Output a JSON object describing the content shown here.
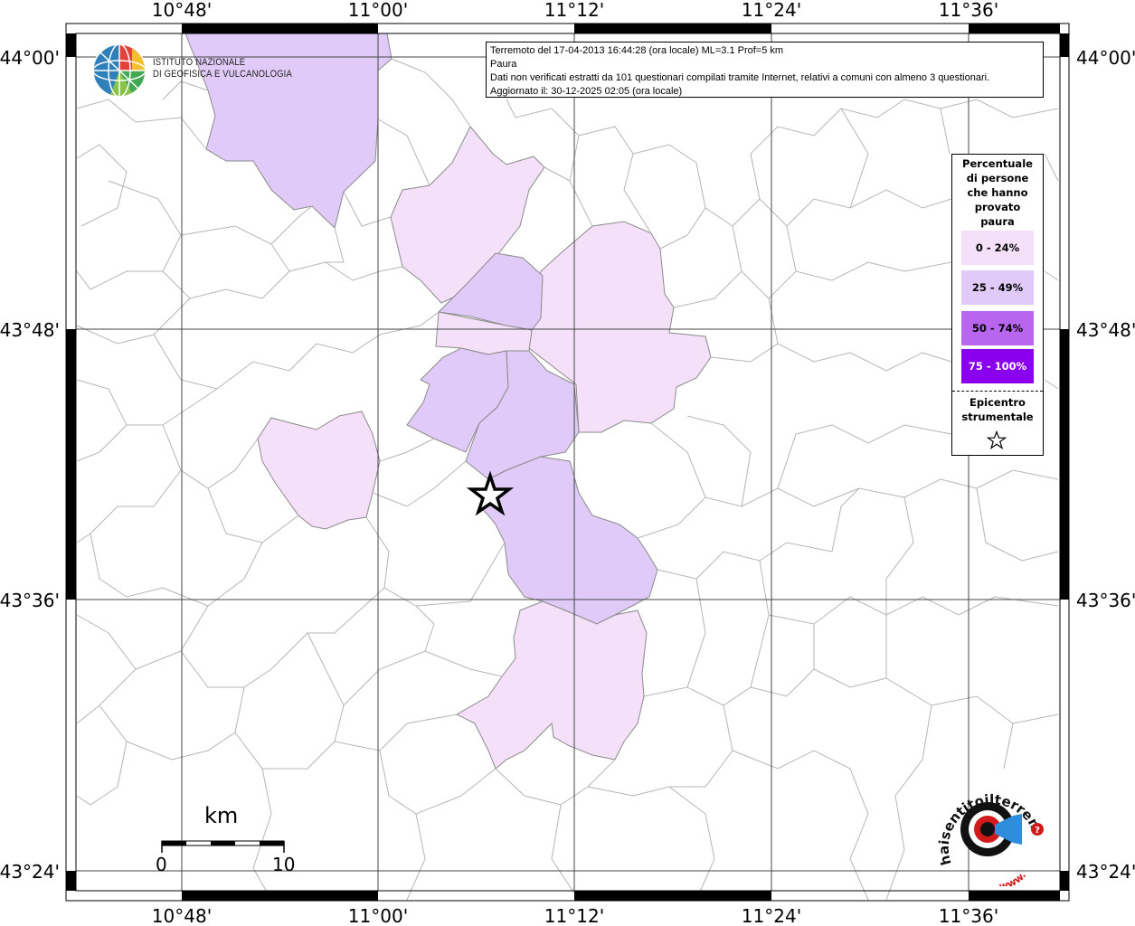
{
  "map": {
    "title_lines": [
      "Terremoto del 17-04-2013 16:44:28 (ora locale) ML=3.1 Prof=5 km",
      "Paura",
      "Dati non verificati estratti da 101 questionari compilati tramite Internet, relativi a comuni con almeno 3 questionari.",
      "Aggiornato il: 30-12-2025 02:05 (ora locale)"
    ],
    "lon_ticks": [
      "10°48'",
      "11°00'",
      "11°12'",
      "11°24'",
      "11°36'"
    ],
    "lat_ticks": [
      "44°00'",
      "43°48'",
      "43°36'",
      "43°24'"
    ]
  },
  "legend": {
    "title_lines": [
      "Percentuale",
      "di persone",
      "che hanno",
      "provato",
      "paura"
    ],
    "classes": [
      {
        "label": "0 - 24%",
        "color": "#f5e0fa"
      },
      {
        "label": "25 - 49%",
        "color": "#e0cbf8"
      },
      {
        "label": "50 - 74%",
        "color": "#b866ef"
      },
      {
        "label": "75 - 100%",
        "color": "#8a00ee"
      }
    ],
    "epicenter_lines": [
      "Epicentro",
      "strumentale"
    ]
  },
  "logo": {
    "ingv_lines": [
      "ISTITUTO NAZIONALE",
      "DI GEOFISICA E VULCANOLOGIA"
    ],
    "hst_text": "haisentitoilterremoto.it",
    "hst_www": "www."
  },
  "scalebar": {
    "unit": "km",
    "start": "0",
    "end": "10"
  }
}
